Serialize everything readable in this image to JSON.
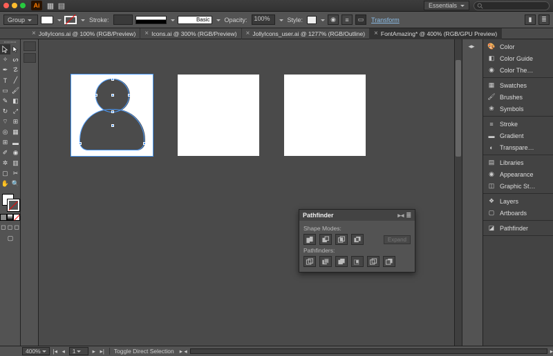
{
  "titlebar": {
    "workspace": "Essentials"
  },
  "control": {
    "selection": "Group",
    "stroke_label": "Stroke:",
    "opacity_label": "Opacity:",
    "opacity_value": "100%",
    "style_label": "Style:",
    "style_value": "Basic",
    "transform_link": "Transform"
  },
  "tabs": [
    {
      "label": "JollyIcons.ai @ 100% (RGB/Preview)",
      "active": false
    },
    {
      "label": "Icons.ai @ 300% (RGB/Preview)",
      "active": false
    },
    {
      "label": "JollyIcons_user.ai @ 1277% (RGB/Outline)",
      "active": false
    },
    {
      "label": "FontAmazing* @ 400% (RGB/GPU Preview)",
      "active": true
    }
  ],
  "right_panels": [
    [
      "Color",
      "Color Guide",
      "Color The…"
    ],
    [
      "Swatches",
      "Brushes",
      "Symbols"
    ],
    [
      "Stroke",
      "Gradient",
      "Transpare…"
    ],
    [
      "Libraries",
      "Appearance",
      "Graphic St…"
    ],
    [
      "Layers",
      "Artboards"
    ],
    [
      "Pathfinder"
    ]
  ],
  "pathfinder": {
    "title": "Pathfinder",
    "shape_modes": "Shape Modes:",
    "pathfinders": "Pathfinders:",
    "expand": "Expand"
  },
  "status": {
    "zoom": "400%",
    "artboard": "1",
    "tip": "Toggle Direct Selection"
  }
}
